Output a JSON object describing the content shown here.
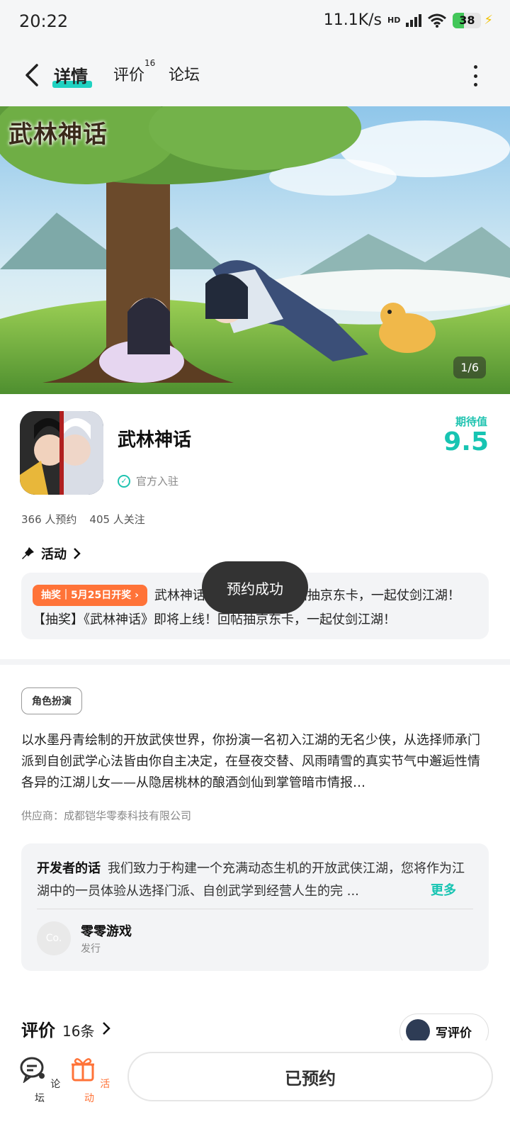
{
  "status_bar": {
    "time": "20:22",
    "network_speed": "11.1K/s",
    "hd_badge": "HD",
    "battery": "38",
    "battery_level_percent": 38
  },
  "nav": {
    "tabs": [
      {
        "label": "详情",
        "active": true
      },
      {
        "label": "评价",
        "badge": "16"
      },
      {
        "label": "论坛"
      }
    ]
  },
  "banner": {
    "logo_text": "武林神话",
    "counter": "1/6"
  },
  "app": {
    "name": "武林神话",
    "official_label": "官方入驻",
    "expect_label": "期待值",
    "expect_value": "9.5",
    "reservations": "366 人预约",
    "followers": "405 人关注"
  },
  "activity": {
    "heading": "活动",
    "tag": "抽奖｜5月25日开奖",
    "text": "武林神话》即将上线！回帖抽京东卡，一起仗剑江湖！【抽奖】《武林神话》即将上线！回帖抽京东卡，一起仗剑江湖！"
  },
  "toast": "预约成功",
  "details": {
    "genre": "角色扮演",
    "description": "以水墨丹青绘制的开放武侠世界，你扮演一名初入江湖的无名少侠，从选择师承门派到自创武学心法皆由你自主决定，在昼夜交替、风雨晴雪的真实节气中邂逅性情各异的江湖儿女——从隐居桃林的酿酒剑仙到掌管暗市情报…",
    "supplier": "供应商：成都铠华零泰科技有限公司"
  },
  "developer": {
    "heading": "开发者的话",
    "text": "我们致力于构建一个充满动态生机的开放武侠江湖，您将作为江湖中的一员体验从选择门派、自创武学到经营人生的完 ...",
    "more": "更多",
    "avatar_text": "Co.",
    "name": "零零游戏",
    "role": "发行"
  },
  "reviews": {
    "title": "评价",
    "count": "16条",
    "write_label": "写评价"
  },
  "bottom": {
    "forum_label": "论坛",
    "activity_label": "活动",
    "reserved_label": "已预约"
  },
  "colors": {
    "accent": "#17c4b2",
    "activity_orange": "#ff7338",
    "toast_bg": "#333333"
  }
}
